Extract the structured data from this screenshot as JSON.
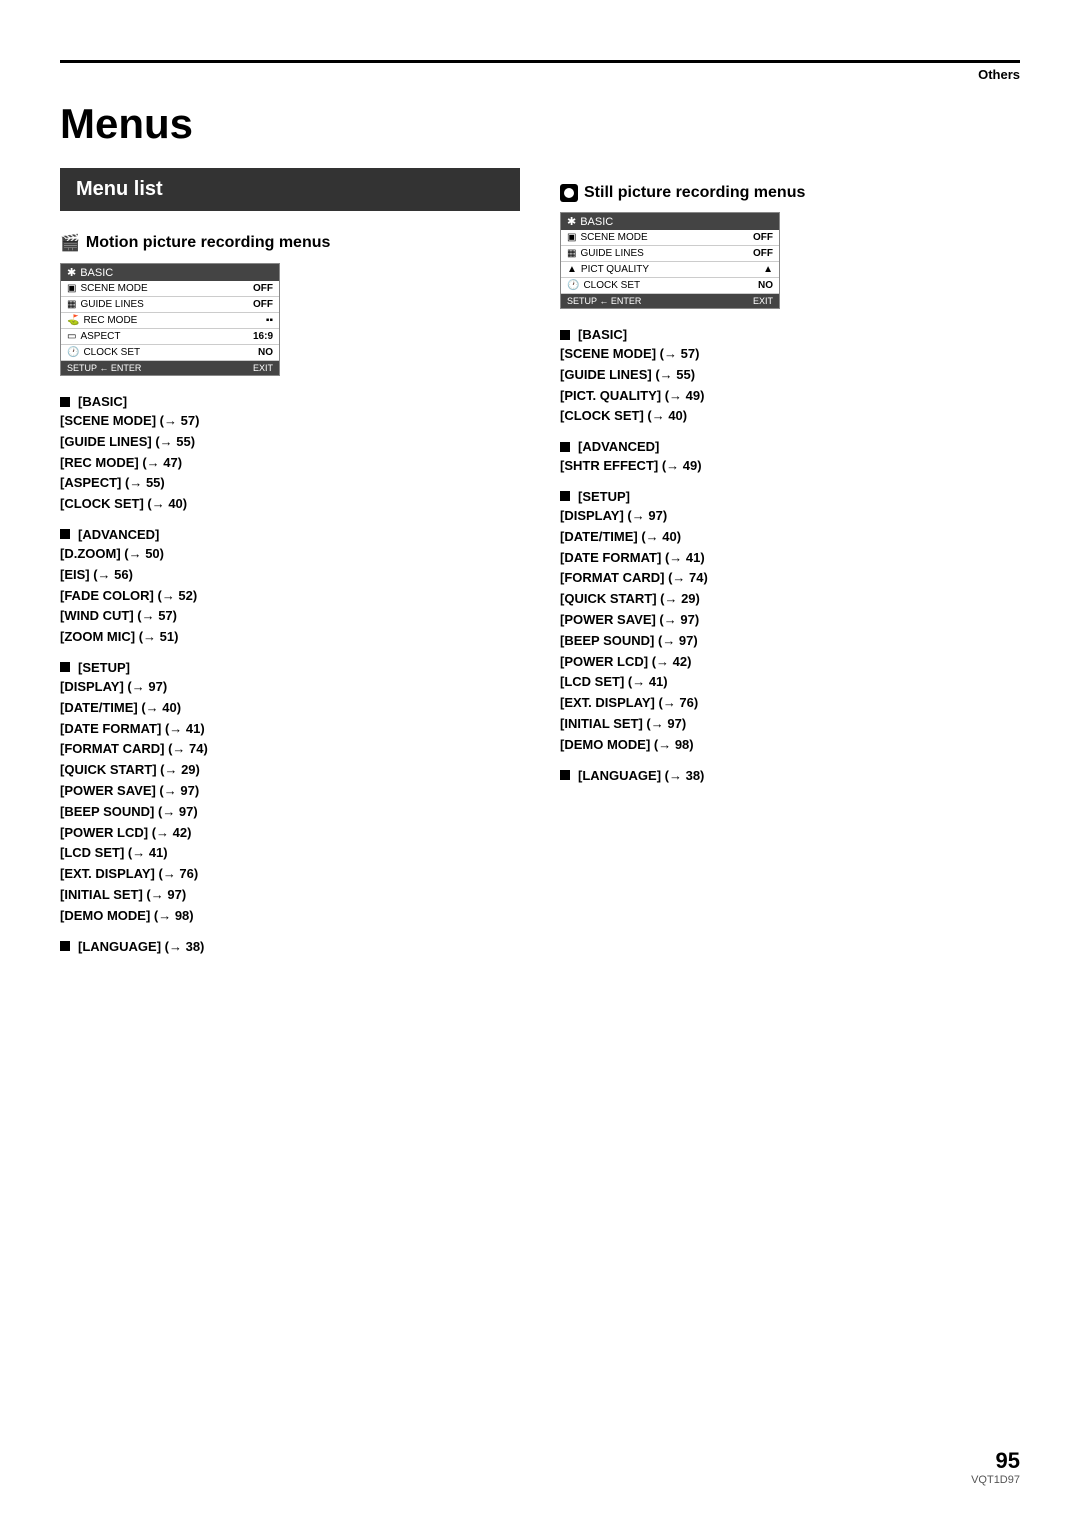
{
  "header": {
    "others_label": "Others"
  },
  "page": {
    "title": "Menus",
    "number": "95",
    "model": "VQT1D97"
  },
  "menu_list": {
    "header_label": "Menu list",
    "motion_section": {
      "heading": "Motion picture recording menus",
      "mini_menu": {
        "tab": "BASIC",
        "rows": [
          {
            "icon": "scene",
            "label": "SCENE MODE",
            "value": "OFF"
          },
          {
            "icon": "guide",
            "label": "GUIDE LINES",
            "value": "OFF"
          },
          {
            "icon": "rec",
            "label": "REC MODE",
            "value": "▪▪"
          },
          {
            "icon": "aspect",
            "label": "ASPECT",
            "value": "16:9"
          },
          {
            "icon": "clock",
            "label": "CLOCK SET",
            "value": "NO"
          }
        ],
        "footer_left": "SETUP ← ENTER",
        "footer_right": "EXIT"
      },
      "basic": {
        "label": "[BASIC]",
        "items": [
          "[SCENE MODE] (→ 57)",
          "[GUIDE LINES] (→ 55)",
          "[REC MODE] (→ 47)",
          "[ASPECT] (→ 55)",
          "[CLOCK SET] (→ 40)"
        ]
      },
      "advanced": {
        "label": "[ADVANCED]",
        "items": [
          "[D.ZOOM] (→ 50)",
          "[EIS] (→ 56)",
          "[FADE COLOR] (→ 52)",
          "[WIND CUT] (→ 57)",
          "[ZOOM MIC] (→ 51)"
        ]
      },
      "setup": {
        "label": "[SETUP]",
        "items": [
          "[DISPLAY] (→ 97)",
          "[DATE/TIME] (→ 40)",
          "[DATE FORMAT] (→ 41)",
          "[FORMAT CARD] (→ 74)",
          "[QUICK START] (→ 29)",
          "[POWER SAVE] (→ 97)",
          "[BEEP SOUND] (→ 97)",
          "[POWER LCD] (→ 42)",
          "[LCD SET] (→ 41)",
          "[EXT. DISPLAY] (→ 76)",
          "[INITIAL SET] (→ 97)",
          "[DEMO MODE] (→ 98)"
        ]
      },
      "language": {
        "label": "[LANGUAGE] (→ 38)"
      }
    },
    "still_section": {
      "heading": "Still picture recording menus",
      "mini_menu": {
        "tab": "BASIC",
        "rows": [
          {
            "icon": "scene",
            "label": "SCENE MODE",
            "value": "OFF"
          },
          {
            "icon": "guide",
            "label": "GUIDE LINES",
            "value": "OFF"
          },
          {
            "icon": "pict",
            "label": "PICT QUALITY",
            "value": "▲"
          },
          {
            "icon": "clock",
            "label": "CLOCK SET",
            "value": "NO"
          }
        ],
        "footer_left": "SETUP ← ENTER",
        "footer_right": "EXIT"
      },
      "basic": {
        "label": "[BASIC]",
        "items": [
          "[SCENE MODE] (→ 57)",
          "[GUIDE LINES] (→ 55)",
          "[PICT. QUALITY] (→ 49)",
          "[CLOCK SET] (→ 40)"
        ]
      },
      "advanced": {
        "label": "[ADVANCED]",
        "items": [
          "[SHTR EFFECT] (→ 49)"
        ]
      },
      "setup": {
        "label": "[SETUP]",
        "items": [
          "[DISPLAY] (→ 97)",
          "[DATE/TIME] (→ 40)",
          "[DATE FORMAT] (→ 41)",
          "[FORMAT CARD] (→ 74)",
          "[QUICK START] (→ 29)",
          "[POWER SAVE] (→ 97)",
          "[BEEP SOUND] (→ 97)",
          "[POWER LCD] (→ 42)",
          "[LCD SET] (→ 41)",
          "[EXT. DISPLAY] (→ 76)",
          "[INITIAL SET] (→ 97)",
          "[DEMO MODE] (→ 98)"
        ]
      },
      "language": {
        "label": "[LANGUAGE] (→ 38)"
      }
    }
  }
}
